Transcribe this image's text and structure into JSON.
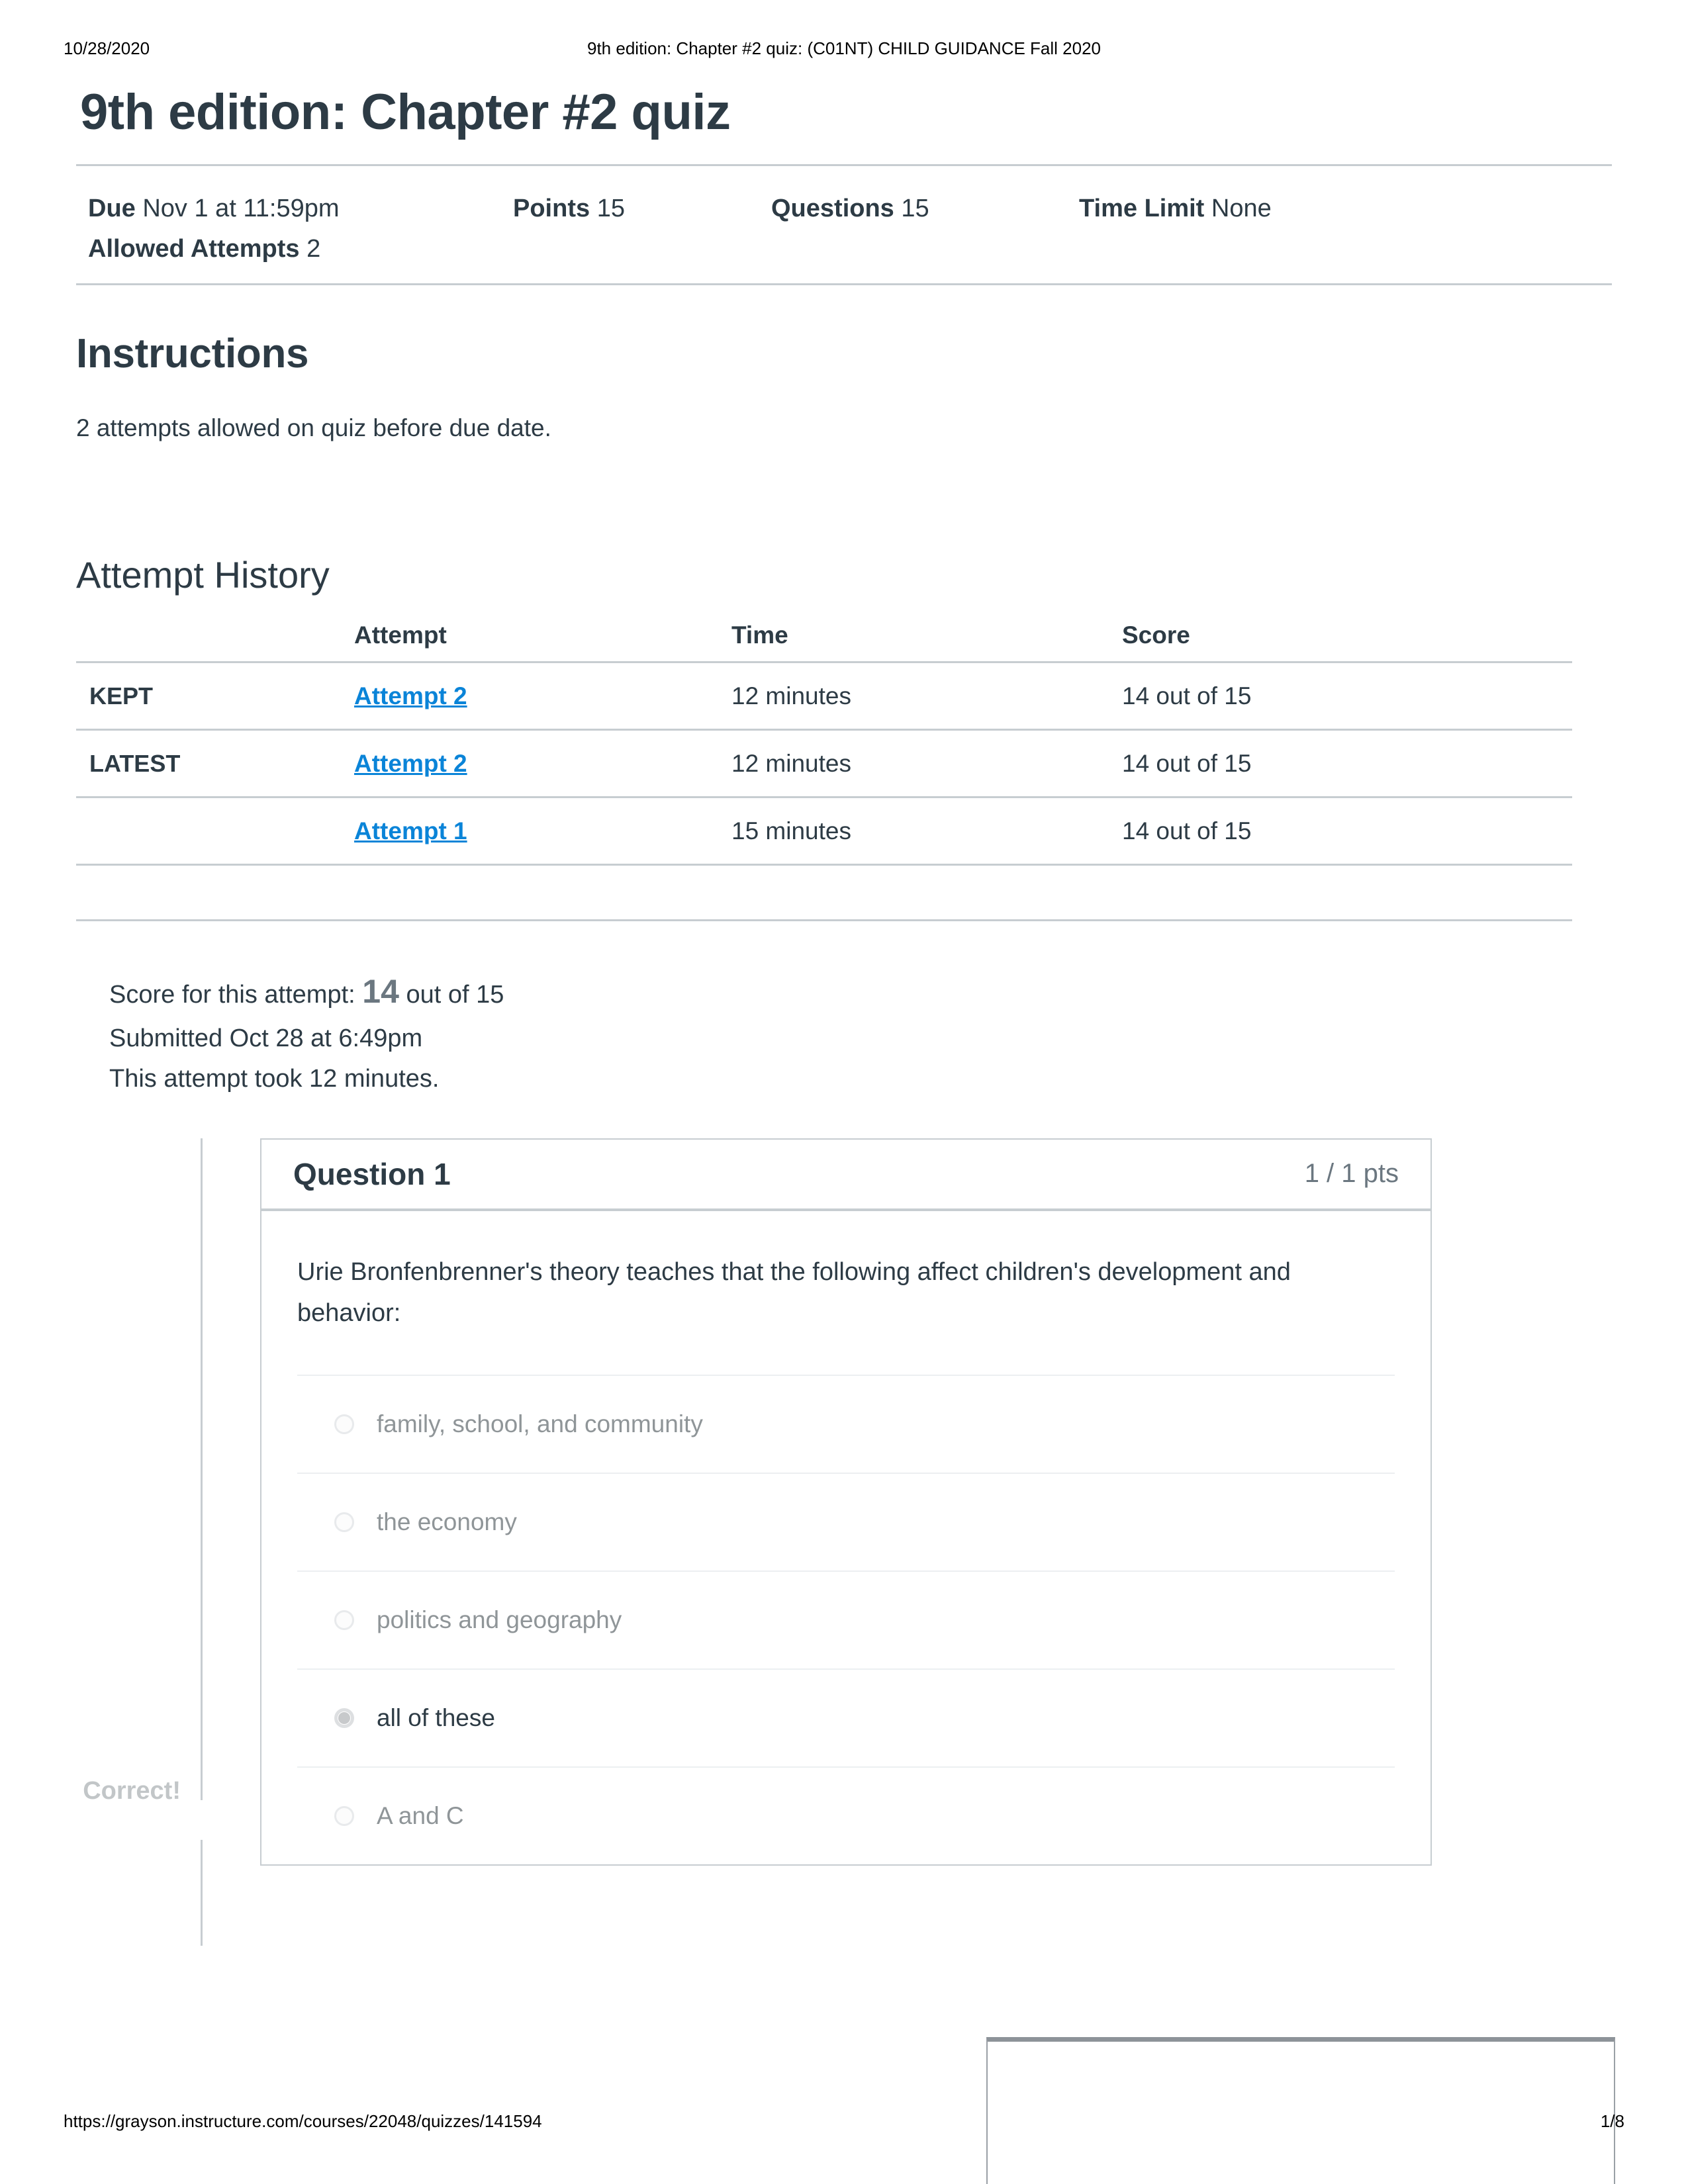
{
  "print_header": {
    "date": "10/28/2020",
    "title": "9th edition: Chapter #2 quiz: (C01NT) CHILD GUIDANCE Fall 2020"
  },
  "print_footer": {
    "url": "https://grayson.instructure.com/courses/22048/quizzes/141594",
    "page": "1/8"
  },
  "quiz": {
    "title": "9th edition: Chapter #2 quiz",
    "meta": {
      "due_label": "Due",
      "due_value": "Nov 1 at 11:59pm",
      "points_label": "Points",
      "points_value": "15",
      "questions_label": "Questions",
      "questions_value": "15",
      "time_limit_label": "Time Limit",
      "time_limit_value": "None",
      "allowed_attempts_label": "Allowed Attempts",
      "allowed_attempts_value": "2"
    }
  },
  "instructions": {
    "heading": "Instructions",
    "text": "2 attempts allowed on quiz before due date."
  },
  "attempt_history": {
    "heading": "Attempt History",
    "columns": {
      "flag": "",
      "attempt": "Attempt",
      "time": "Time",
      "score": "Score"
    },
    "rows": [
      {
        "flag": "KEPT",
        "attempt": "Attempt 2",
        "time": "12 minutes",
        "score": "14 out of 15"
      },
      {
        "flag": "LATEST",
        "attempt": "Attempt 2",
        "time": "12 minutes",
        "score": "14 out of 15"
      },
      {
        "flag": "",
        "attempt": "Attempt 1",
        "time": "15 minutes",
        "score": "14 out of 15"
      }
    ]
  },
  "attempt_summary": {
    "score_prefix": "Score for this attempt:",
    "score_value": "14",
    "score_suffix": "out of 15",
    "submitted": "Submitted Oct 28 at 6:49pm",
    "duration": "This attempt took 12 minutes."
  },
  "question": {
    "name": "Question 1",
    "points": "1 / 1 pts",
    "text": "Urie Bronfenbrenner's theory teaches that the following affect children's development and behavior:",
    "correct_label": "Correct!",
    "answers": [
      {
        "text": "family, school, and community",
        "selected": false
      },
      {
        "text": "the economy",
        "selected": false
      },
      {
        "text": "politics and geography",
        "selected": false
      },
      {
        "text": "all of these",
        "selected": true
      },
      {
        "text": "A and C",
        "selected": false
      }
    ]
  },
  "colors": {
    "link": "#0a84d8",
    "rule": "#c7cdd1",
    "text": "#2d3b45",
    "muted": "#8f9598"
  }
}
